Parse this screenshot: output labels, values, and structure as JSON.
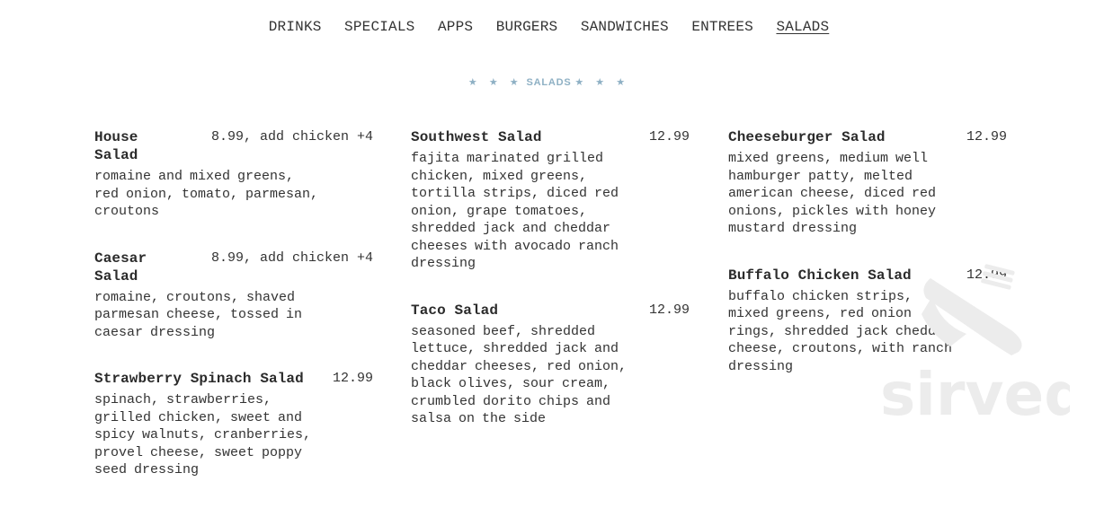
{
  "nav": {
    "items": [
      {
        "label": "DRINKS",
        "active": false
      },
      {
        "label": "SPECIALS",
        "active": false
      },
      {
        "label": "APPS",
        "active": false
      },
      {
        "label": "BURGERS",
        "active": false
      },
      {
        "label": "SANDWICHES",
        "active": false
      },
      {
        "label": "ENTREES",
        "active": false
      },
      {
        "label": "SALADS",
        "active": true
      }
    ]
  },
  "section": {
    "stars_left": "★ ★ ★",
    "title": "SALADS",
    "stars_right": "★ ★ ★"
  },
  "columns": [
    [
      {
        "name": "House Salad",
        "price": "8.99, add chicken +4",
        "desc": "romaine and mixed greens, red onion, tomato, parmesan, croutons"
      },
      {
        "name": "Caesar Salad",
        "price": "8.99, add chicken +4",
        "desc": "romaine, croutons, shaved parmesan cheese, tossed in caesar dressing"
      },
      {
        "name": "Strawberry Spinach Salad",
        "price": "12.99",
        "desc": "spinach, strawberries, grilled chicken, sweet and spicy walnuts, cranberries, provel cheese, sweet poppy seed dressing"
      }
    ],
    [
      {
        "name": "Southwest Salad",
        "price": "12.99",
        "desc": "fajita marinated grilled chicken, mixed greens, tortilla strips, diced red onion, grape tomatoes, shredded jack and cheddar cheeses with avocado ranch dressing"
      },
      {
        "name": "Taco Salad",
        "price": "12.99",
        "desc": "seasoned beef, shredded lettuce, shredded jack and cheddar cheeses, red onion, black olives, sour cream, crumbled dorito chips and salsa on the side"
      }
    ],
    [
      {
        "name": "Cheeseburger Salad",
        "price": "12.99",
        "desc": "mixed greens, medium well hamburger patty, melted american cheese, diced red onions, pickles with honey mustard dressing"
      },
      {
        "name": "Buffalo Chicken Salad",
        "price": "12.99",
        "desc": "buffalo chicken strips, mixed greens, red onion rings, shredded jack cheddar cheese, croutons, with ranch dressing"
      }
    ]
  ],
  "watermark": {
    "text": "sirved",
    "icon": "fork-knife-icon",
    "color": "#e9e9e9"
  },
  "colors": {
    "heading_accent": "#8eb0c4",
    "text": "#333333"
  }
}
